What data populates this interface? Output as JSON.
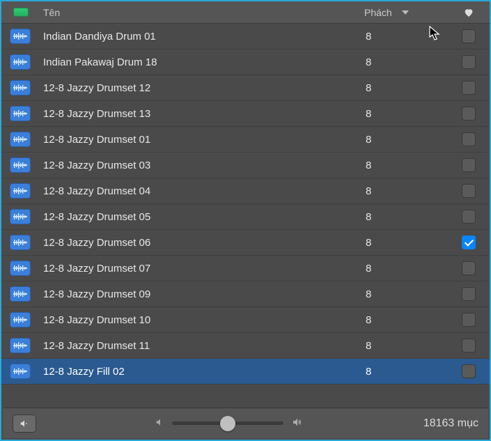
{
  "header": {
    "name_label": "Tên",
    "beats_label": "Phách"
  },
  "rows": [
    {
      "name": "Indian Dandiya Drum 01",
      "beats": "8",
      "favorite": false,
      "selected": false
    },
    {
      "name": "Indian Pakawaj Drum 18",
      "beats": "8",
      "favorite": false,
      "selected": false
    },
    {
      "name": "12-8 Jazzy Drumset 12",
      "beats": "8",
      "favorite": false,
      "selected": false
    },
    {
      "name": "12-8 Jazzy Drumset 13",
      "beats": "8",
      "favorite": false,
      "selected": false
    },
    {
      "name": "12-8 Jazzy Drumset 01",
      "beats": "8",
      "favorite": false,
      "selected": false
    },
    {
      "name": "12-8 Jazzy Drumset 03",
      "beats": "8",
      "favorite": false,
      "selected": false
    },
    {
      "name": "12-8 Jazzy Drumset 04",
      "beats": "8",
      "favorite": false,
      "selected": false
    },
    {
      "name": "12-8 Jazzy Drumset 05",
      "beats": "8",
      "favorite": false,
      "selected": false
    },
    {
      "name": "12-8 Jazzy Drumset 06",
      "beats": "8",
      "favorite": true,
      "selected": false
    },
    {
      "name": "12-8 Jazzy Drumset 07",
      "beats": "8",
      "favorite": false,
      "selected": false
    },
    {
      "name": "12-8 Jazzy Drumset 09",
      "beats": "8",
      "favorite": false,
      "selected": false
    },
    {
      "name": "12-8 Jazzy Drumset 10",
      "beats": "8",
      "favorite": false,
      "selected": false
    },
    {
      "name": "12-8 Jazzy Drumset 11",
      "beats": "8",
      "favorite": false,
      "selected": false
    },
    {
      "name": "12-8 Jazzy Fill 02",
      "beats": "8",
      "favorite": false,
      "selected": true
    }
  ],
  "footer": {
    "item_count": "18163 mục",
    "volume_percent": 50
  },
  "icons": {
    "loop": "audio-loop-icon",
    "chevron": "chevron-down-icon",
    "heart": "heart-icon",
    "speaker_preview": "speaker-preview-icon",
    "speaker_small": "speaker-small-icon",
    "speaker_large": "speaker-large-icon"
  }
}
